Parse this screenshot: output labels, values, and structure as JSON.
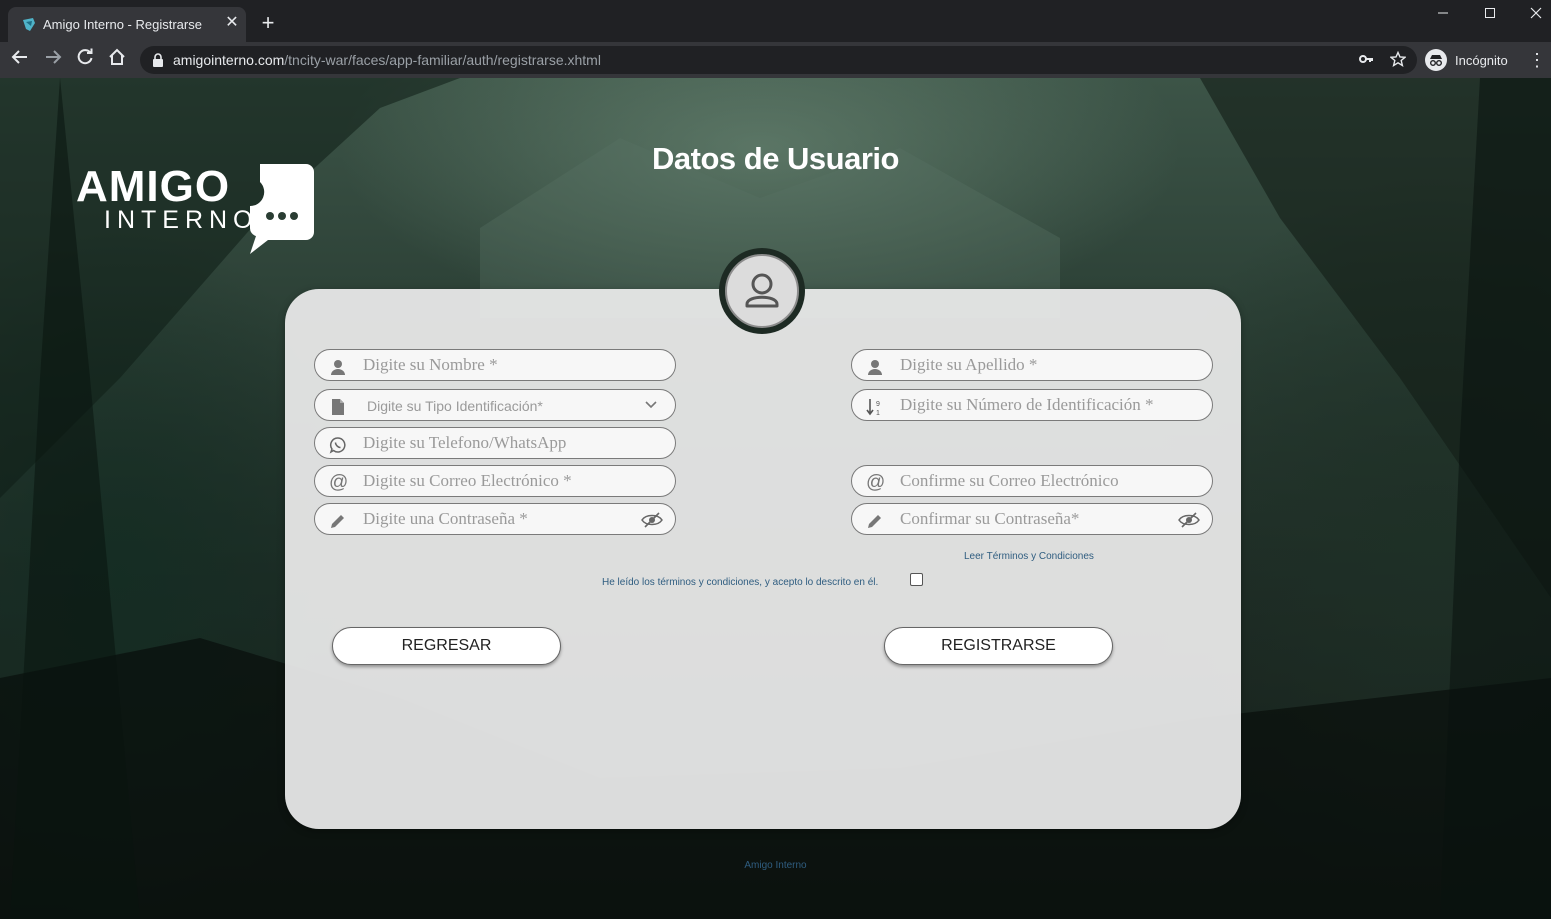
{
  "browser": {
    "tab_title": "Amigo Interno - Registrarse",
    "new_tab_label": "+",
    "url_host": "amigointerno.com",
    "url_path": "/tncity-war/faces/app-familiar/auth/registrarse.xhtml",
    "incognito_label": "Incógnito"
  },
  "logo": {
    "line1": "AMIGO",
    "line2": "INTERNO"
  },
  "page": {
    "title": "Datos de Usuario"
  },
  "form": {
    "nombre_placeholder": "Digite su Nombre *",
    "apellido_placeholder": "Digite su Apellido *",
    "tipo_identificacion_placeholder": "Digite su Tipo Identificación*",
    "numero_identificacion_placeholder": "Digite su Número de Identificación *",
    "telefono_placeholder": "Digite su Telefono/WhatsApp",
    "correo_placeholder": "Digite su Correo Electrónico *",
    "confirmar_correo_placeholder": "Confirme su Correo Electrónico",
    "contrasena_placeholder": "Digite una Contraseña *",
    "confirmar_contrasena_placeholder": "Confirmar su Contraseña*",
    "terms_link": "Leer Términos y Condiciones",
    "terms_accept": "He leído los términos y condiciones, y acepto lo descrito en él.",
    "regresar_label": "REGRESAR",
    "registrarse_label": "REGISTRARSE"
  },
  "footer": {
    "text": "Amigo Interno"
  },
  "colors": {
    "chrome_dark": "#202124",
    "chrome_toolbar": "#35363a",
    "card_bg": "#ececec",
    "link_blue": "#2f5d80"
  }
}
